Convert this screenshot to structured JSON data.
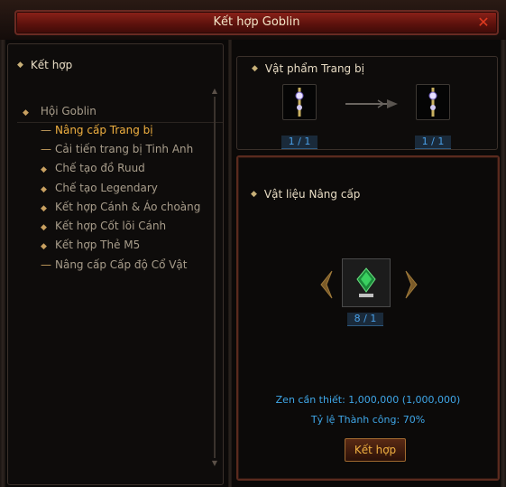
{
  "window": {
    "title": "Kết hợp Goblin"
  },
  "left_panel": {
    "header": "Kết hợp",
    "tree_root": "Hội Goblin",
    "items": [
      {
        "label": "Nâng cấp Trang bị",
        "marker": "dash",
        "selected": true
      },
      {
        "label": "Cải tiến trang bị Tinh Anh",
        "marker": "dash",
        "selected": false
      },
      {
        "label": "Chế tạo đồ Ruud",
        "marker": "plus",
        "selected": false
      },
      {
        "label": "Chế tạo Legendary",
        "marker": "plus",
        "selected": false
      },
      {
        "label": "Kết hợp Cánh & Áo choàng",
        "marker": "plus",
        "selected": false
      },
      {
        "label": "Kết hợp Cốt lõi Cánh",
        "marker": "plus",
        "selected": false
      },
      {
        "label": "Kết hợp Thẻ M5",
        "marker": "plus",
        "selected": false
      },
      {
        "label": "Nâng cấp Cấp độ Cổ Vật",
        "marker": "dash",
        "selected": false
      }
    ]
  },
  "equipment": {
    "header": "Vật phẩm Trang bị",
    "source_count": "1 / 1",
    "result_count": "1 / 1"
  },
  "materials": {
    "header": "Vật liệu Nâng cấp",
    "material_count": "8 / 1",
    "zen_required": "Zen cần thiết: 1,000,000 (1,000,000)",
    "success_rate": "Tỷ lệ Thành công: 70%",
    "combine_button": "Kết hợp"
  },
  "colors": {
    "selected_text": "#f0b040",
    "info_text": "#3fa7e8",
    "title_bar": "#8c2219"
  }
}
